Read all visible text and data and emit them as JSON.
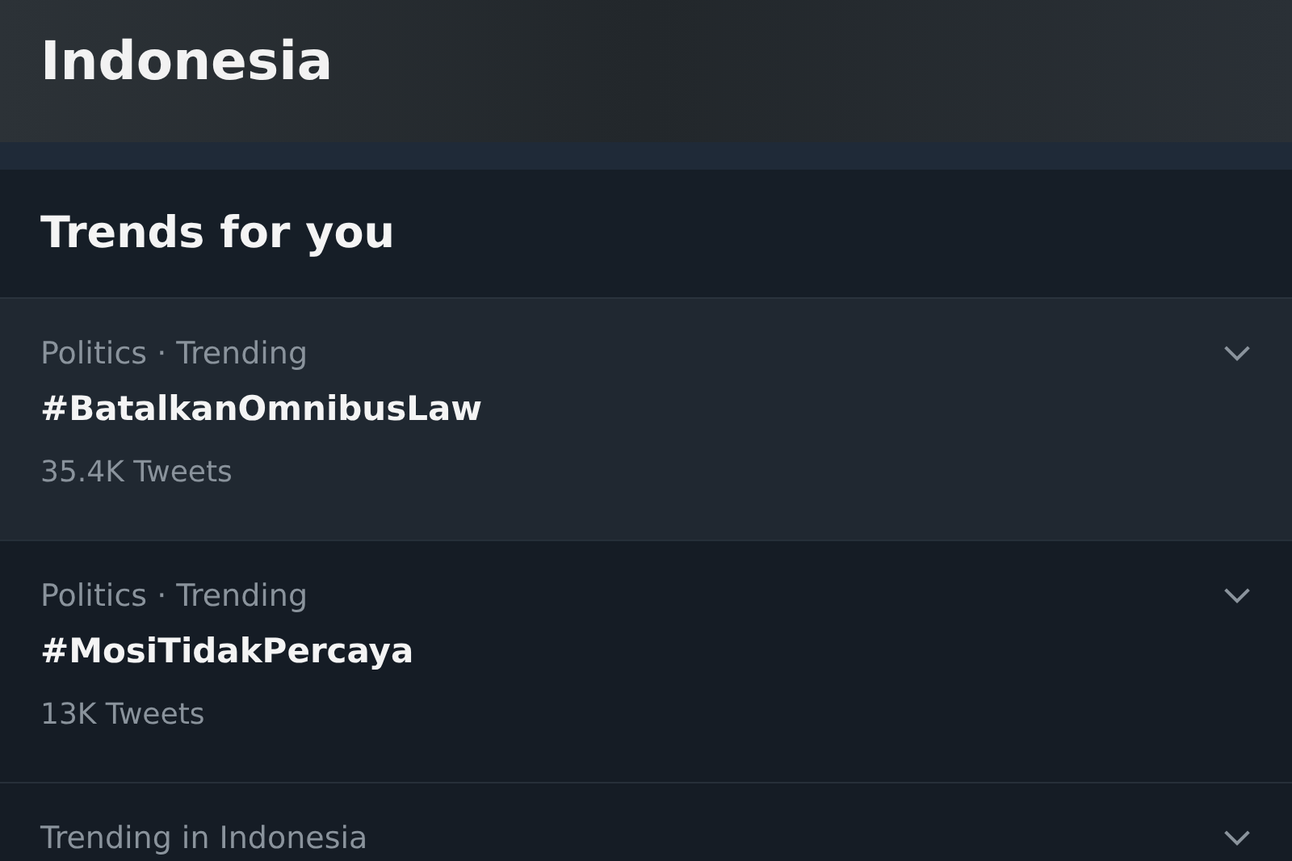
{
  "headline": {
    "title": "Indonesia"
  },
  "trends_panel": {
    "heading": "Trends for you",
    "items": [
      {
        "context": "Politics · Trending",
        "name": "#BatalkanOmnibusLaw",
        "count": "35.4K Tweets",
        "hovered": true
      },
      {
        "context": "Politics · Trending",
        "name": "#MosiTidakPercaya",
        "count": "13K Tweets",
        "hovered": false
      },
      {
        "context": "Trending in Indonesia",
        "hovered": false
      }
    ]
  }
}
